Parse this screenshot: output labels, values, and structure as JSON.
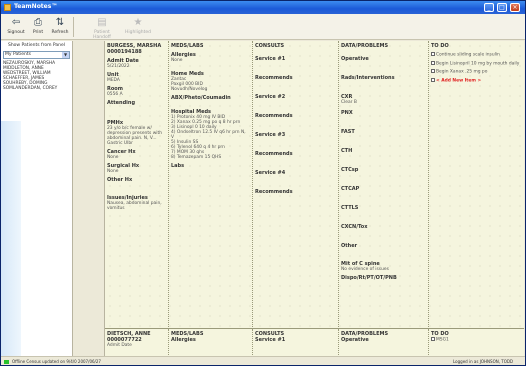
{
  "window": {
    "title": "TeamNotes™"
  },
  "toolbar": {
    "items": [
      {
        "label": "Signout",
        "icon": "signout-icon",
        "glyph": "⇦"
      },
      {
        "label": "Print",
        "icon": "print-icon",
        "glyph": "⎙"
      },
      {
        "label": "Refresh",
        "icon": "refresh-icon",
        "glyph": "⇅"
      },
      {
        "label": "Patient Handoff",
        "icon": "handoff-icon",
        "glyph": "▤"
      },
      {
        "label": "Highlighted",
        "icon": "star-icon",
        "glyph": "★"
      }
    ]
  },
  "left_pane": {
    "header": "Show Patients from Panel",
    "selected_panel": "My Patients",
    "patients": [
      "NEZAUROSKIY, MARSHA",
      "MIDDLETON, ANNE",
      "WEDSTREET, WILLIAM",
      "SCHAEFFER, JAMES",
      "SOUHREBY, DOMING",
      "SOMLANDERDAN, COREY"
    ]
  },
  "patient": {
    "name": "BURGESS, MARSHA",
    "mrn": "0000194188",
    "admit_label": "Admit Date",
    "admit_date": "5/21/2022",
    "unit_label": "Unit",
    "unit": "MEDA",
    "room_label": "Room",
    "room": "0556 A",
    "attending_label": "Attending",
    "pmhx_label": "PMHx",
    "pmhx": "23 y/o b/c female w/ depression presents with abdominal pain. N, V... Gastric Ulbr",
    "cancer_label": "Cancer Hx",
    "cancer": "None",
    "surgical_label": "Surgical Hx",
    "surgical": "None",
    "other_label": "Other Hx",
    "issues_label": "Issues/Injuries",
    "issues": "Nausea, abdominal pain, vomitus"
  },
  "meds": {
    "header": "MEDS/LABS",
    "allergies_label": "Allergies",
    "allergies": "None",
    "home_meds_label": "Home Meds",
    "home_meds": [
      "Zantac",
      "Paxgil 000 BID",
      "Novudh/Novelog"
    ],
    "abx_label": "ABX/Pheto/Coumadin",
    "hospital_label": "Hospital Meds",
    "hospital_meds": [
      "1) Protonix 40 mg IV BID",
      "2) Xanax 0.25 mg po q 8 hr prn",
      "3) Lisinopl 0 10 daily",
      "4) Ondseltron 12.5 IV q6 hr prn N, V",
      "5) Insulin SS",
      "6) Tylenol 640 q 4 hr prn",
      "7) MOM 30 qhs",
      "8) Temazepam 15 QHS"
    ],
    "labs_label": "Labs"
  },
  "consults": {
    "header": "CONSULTS",
    "entries": [
      {
        "service": "Service #1",
        "recommend": "Recommends"
      },
      {
        "service": "Service #2",
        "recommend": "Recommends"
      },
      {
        "service": "Service #3",
        "recommend": "Recommends"
      },
      {
        "service": "Service #4",
        "recommend": "Recommends"
      }
    ]
  },
  "data_problems": {
    "header": "DATA/PROBLEMS",
    "items": [
      {
        "label": "Operative",
        "value": ""
      },
      {
        "label": "Rads/Interventions",
        "value": ""
      },
      {
        "label": "CXR",
        "value": "Clear B"
      },
      {
        "label": "PNX",
        "value": ""
      },
      {
        "label": "FAST",
        "value": ""
      },
      {
        "label": "CTH",
        "value": ""
      },
      {
        "label": "CTCsp",
        "value": ""
      },
      {
        "label": "CTCAP",
        "value": ""
      },
      {
        "label": "CTTLS",
        "value": ""
      },
      {
        "label": "CXCN/Tox",
        "value": ""
      },
      {
        "label": "Other",
        "value": ""
      },
      {
        "label": "Mit of C spine",
        "value": "No evidence of issues"
      },
      {
        "label": "Dispo/Rt/PT/OT/PNB",
        "value": ""
      }
    ]
  },
  "todo": {
    "header": "TO DO",
    "items": [
      "Continue sliding scale insulin",
      "Begin Lisinopril 10 mg by mouth daily",
      "Begin Xanax .25 mg po"
    ],
    "add_label": "< Add New Item >"
  },
  "patient2": {
    "name": "DIETSCH, ANNE",
    "mrn": "0000077722",
    "admit_label": "Admit Date",
    "allergies_label": "Allergies",
    "service_label": "Service #1",
    "operative_label": "Operative",
    "todo_item": "MSG1"
  },
  "status": {
    "left": "Offline Census updated on 9/4/0  2007/06/27",
    "right": "Logged in as JOHNSON, TODD"
  }
}
